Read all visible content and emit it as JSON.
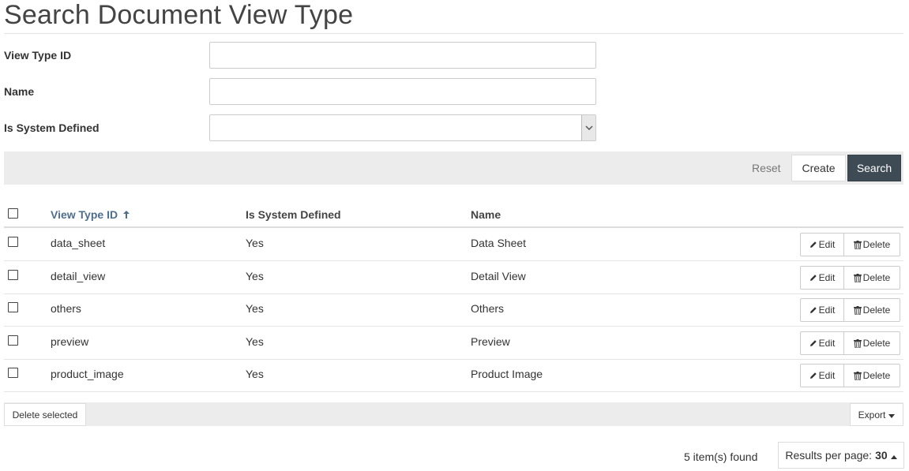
{
  "page": {
    "title": "Search Document View Type"
  },
  "form": {
    "view_type_id": {
      "label": "View Type ID",
      "value": "",
      "placeholder": ""
    },
    "name": {
      "label": "Name",
      "value": "",
      "placeholder": ""
    },
    "is_system_defined": {
      "label": "Is System Defined",
      "selected": ""
    }
  },
  "actions": {
    "reset": "Reset",
    "create": "Create",
    "search": "Search"
  },
  "table": {
    "columns": {
      "view_type_id": "View Type ID",
      "is_system_defined": "Is System Defined",
      "name": "Name"
    },
    "sort_icon": "arrow-up-icon",
    "row_actions": {
      "edit": "Edit",
      "delete": "Delete"
    },
    "rows": [
      {
        "view_type_id": "data_sheet",
        "is_system_defined": "Yes",
        "name": "Data Sheet"
      },
      {
        "view_type_id": "detail_view",
        "is_system_defined": "Yes",
        "name": "Detail View"
      },
      {
        "view_type_id": "others",
        "is_system_defined": "Yes",
        "name": "Others"
      },
      {
        "view_type_id": "preview",
        "is_system_defined": "Yes",
        "name": "Preview"
      },
      {
        "view_type_id": "product_image",
        "is_system_defined": "Yes",
        "name": "Product Image"
      }
    ]
  },
  "footer": {
    "delete_selected": "Delete selected",
    "export": "Export",
    "items_found": "5 item(s) found",
    "results_per_page_label": "Results per page:",
    "results_per_page_value": "30"
  },
  "colors": {
    "primary_button": "#3e4b55",
    "link": "#4f6e8c",
    "bar_background": "#ececec"
  }
}
